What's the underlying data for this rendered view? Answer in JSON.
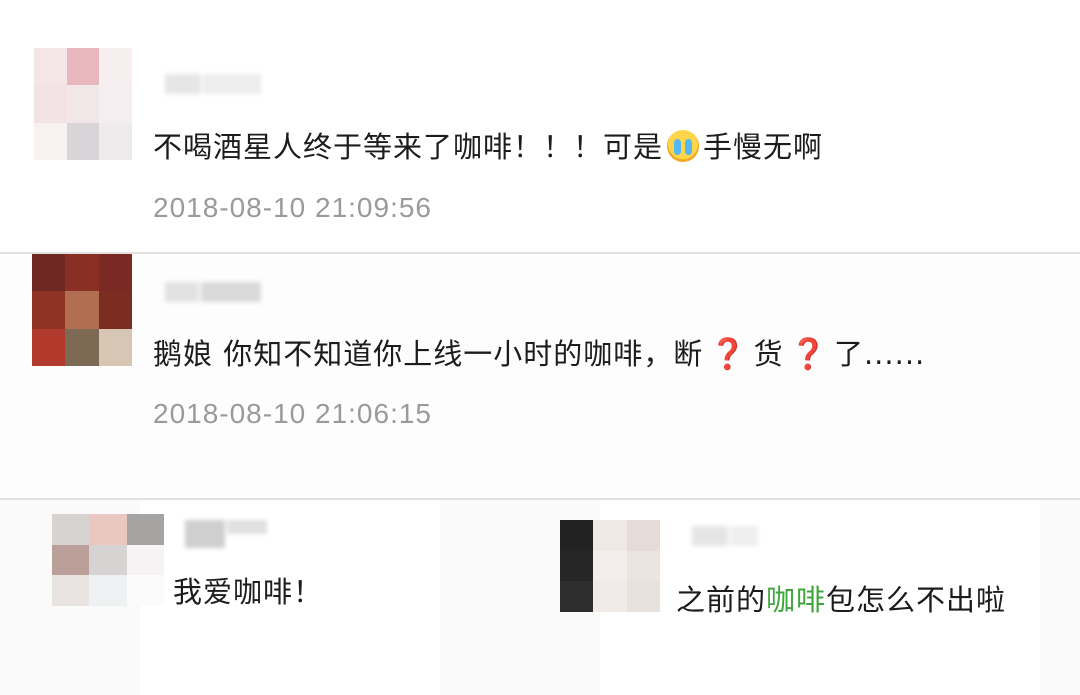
{
  "comments": [
    {
      "text_before": "不喝酒星人终于等来了咖啡！！！可是",
      "emoji": "crying-face-icon",
      "text_after": "手慢无啊",
      "timestamp": "2018-08-10 21:09:56"
    },
    {
      "text_1": "鹅娘 你知不知道你上线一小时的咖啡，断",
      "text_2": "货",
      "text_3": "了......",
      "qmark": "❓",
      "timestamp": "2018-08-10 21:06:15"
    }
  ],
  "snippets": [
    {
      "text": "我爱咖啡！"
    },
    {
      "text_before": "之前的",
      "highlight": "咖啡",
      "text_after": "包怎么不出啦",
      "highlight_color": "#3ea53a"
    }
  ]
}
